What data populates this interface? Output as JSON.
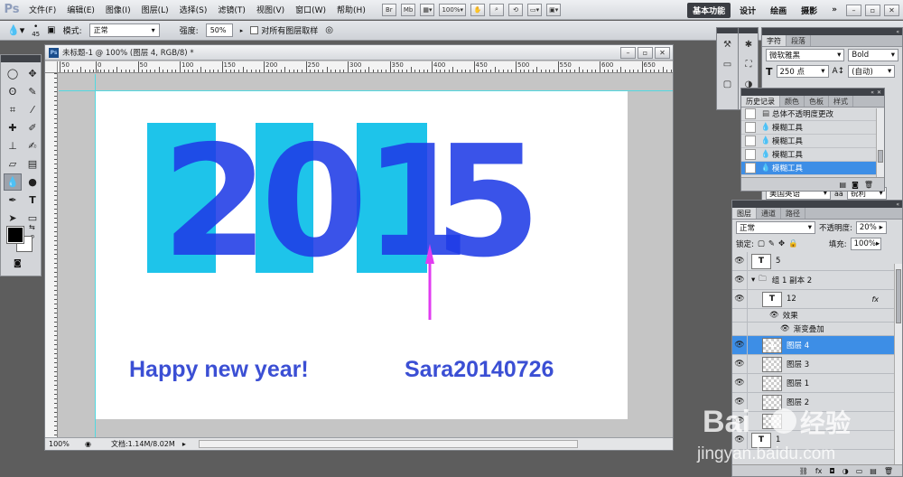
{
  "app": {
    "logo": "Ps"
  },
  "menu": [
    "文件(F)",
    "编辑(E)",
    "图像(I)",
    "图层(L)",
    "选择(S)",
    "滤镜(T)",
    "视图(V)",
    "窗口(W)",
    "帮助(H)"
  ],
  "menubar_tools": {
    "br": "Br",
    "mb": "Mb",
    "zoom": "100%"
  },
  "workspace": {
    "active": "基本功能",
    "items": [
      "设计",
      "绘画",
      "摄影"
    ],
    "more": "»"
  },
  "options": {
    "brush_size": "45",
    "mode_label": "模式:",
    "mode_value": "正常",
    "strength_label": "强度:",
    "strength_value": "50%",
    "sample_all_label": "对所有图层取样"
  },
  "document": {
    "title": "未标题-1 @ 100% (图层 4, RGB/8) *",
    "ruler_labels": [
      "50",
      "0",
      "50",
      "100",
      "150",
      "200",
      "250",
      "300",
      "350",
      "400",
      "450",
      "500",
      "550",
      "600",
      "650"
    ],
    "status_zoom": "100%",
    "status_doc": "文档:1.14M/8.02M"
  },
  "artwork": {
    "digits": [
      "2",
      "0",
      "1",
      "5"
    ],
    "digit_color": "#1f3be6",
    "rect_color": "#1ec4ea",
    "greeting": "Happy new year!",
    "author": "Sara20140726",
    "text_color": "#3b4fd4",
    "arrow_color": "#e13cf0"
  },
  "character_panel": {
    "tabs": [
      "字符",
      "段落"
    ],
    "font_family": "微软雅黑",
    "font_style": "Bold",
    "font_size": "250 点",
    "leading": "(自动)",
    "language": "美国英语",
    "antialias": "锐利"
  },
  "history_panel": {
    "tabs": [
      "历史记录",
      "颜色",
      "色板",
      "样式"
    ],
    "items": [
      {
        "label": "总体不透明度更改",
        "selected": false
      },
      {
        "label": "模糊工具",
        "selected": false
      },
      {
        "label": "模糊工具",
        "selected": false
      },
      {
        "label": "模糊工具",
        "selected": false
      },
      {
        "label": "模糊工具",
        "selected": true
      }
    ]
  },
  "layers_panel": {
    "tabs": [
      "图层",
      "通道",
      "路径"
    ],
    "blend_mode": "正常",
    "opacity_label": "不透明度:",
    "opacity_value": "20%",
    "lock_label": "锁定:",
    "fill_label": "填充:",
    "fill_value": "100%",
    "layers": [
      {
        "name": "5",
        "thumb": "T",
        "type": "text",
        "indent": 0,
        "selected": false
      },
      {
        "name": "组 1 副本 2",
        "thumb": "",
        "type": "group",
        "indent": 0,
        "selected": false
      },
      {
        "name": "12",
        "thumb": "T",
        "type": "text",
        "indent": 1,
        "selected": false,
        "fx": "fx"
      },
      {
        "name": "效果",
        "thumb": "",
        "type": "effect",
        "indent": 2,
        "selected": false
      },
      {
        "name": "渐变叠加",
        "thumb": "",
        "type": "effect",
        "indent": 3,
        "selected": false
      },
      {
        "name": "图层 4",
        "thumb": "1",
        "type": "pixel",
        "indent": 1,
        "selected": true
      },
      {
        "name": "图层 3",
        "thumb": "",
        "type": "pixel",
        "indent": 1,
        "selected": false
      },
      {
        "name": "图层 1",
        "thumb": "",
        "type": "pixel",
        "indent": 1,
        "selected": false
      },
      {
        "name": "图层 2",
        "thumb": "",
        "type": "pixel",
        "indent": 1,
        "selected": false
      },
      {
        "name": "",
        "thumb": "",
        "type": "pixel",
        "indent": 1,
        "selected": false
      },
      {
        "name": "1",
        "thumb": "T",
        "type": "text",
        "indent": 0,
        "selected": false
      }
    ]
  },
  "watermark": {
    "line1": "Bai",
    "line2": "经验",
    "url": "jingyan.baidu.com"
  }
}
